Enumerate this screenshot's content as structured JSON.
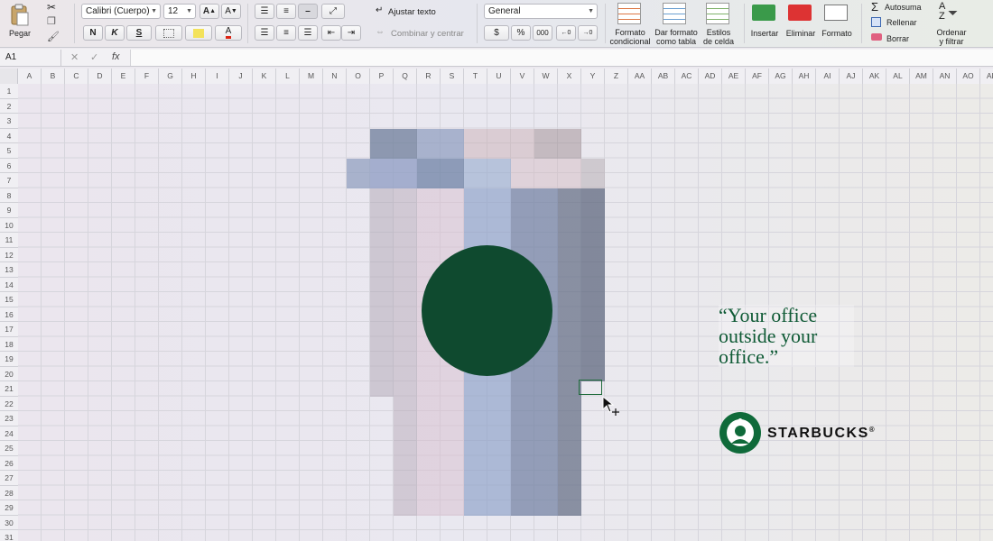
{
  "ribbon": {
    "paste_label": "Pegar",
    "font_name": "Calibri (Cuerpo)",
    "font_size": "12",
    "bold": "N",
    "italic": "K",
    "underline": "S",
    "wrap_text": "Ajustar texto",
    "merge_center": "Combinar y centrar",
    "number_format": "General",
    "currency": "$",
    "percent": "%",
    "thousands": "000",
    "conditional_format": [
      "Formato",
      "condicional"
    ],
    "format_table": [
      "Dar formato",
      "como tabla"
    ],
    "cell_styles": [
      "Estilos",
      "de celda"
    ],
    "insert": "Insertar",
    "delete": "Eliminar",
    "format": "Formato",
    "autosum": "Autosuma",
    "fill": "Rellenar",
    "clear": "Borrar",
    "sort_filter": [
      "Ordenar",
      "y filtrar"
    ]
  },
  "formula_bar": {
    "name_box": "A1",
    "fx": "fx",
    "formula": ""
  },
  "columns": [
    "A",
    "B",
    "C",
    "D",
    "E",
    "F",
    "G",
    "H",
    "I",
    "J",
    "K",
    "L",
    "M",
    "N",
    "O",
    "P",
    "Q",
    "R",
    "S",
    "T",
    "U",
    "V",
    "W",
    "X",
    "Y",
    "Z",
    "AA",
    "AB",
    "AC",
    "AD",
    "AE",
    "AF",
    "AG",
    "AH",
    "AI",
    "AJ",
    "AK",
    "AL",
    "AM",
    "AN",
    "AO",
    "AP"
  ],
  "rows": [
    "1",
    "2",
    "3",
    "4",
    "5",
    "6",
    "7",
    "8",
    "9",
    "10",
    "11",
    "12",
    "13",
    "14",
    "15",
    "16",
    "17",
    "18",
    "19",
    "20",
    "21",
    "22",
    "23",
    "24",
    "25",
    "26",
    "27",
    "28",
    "29",
    "30",
    "31"
  ],
  "ad": {
    "quote": "“Your office outside your office.”",
    "brand": "STARBUCKS",
    "registered": "®"
  },
  "colors": {
    "brand_green": "#0f4a2f",
    "quote_green": "#0f5a35",
    "selection_green": "#1f6b3b"
  }
}
